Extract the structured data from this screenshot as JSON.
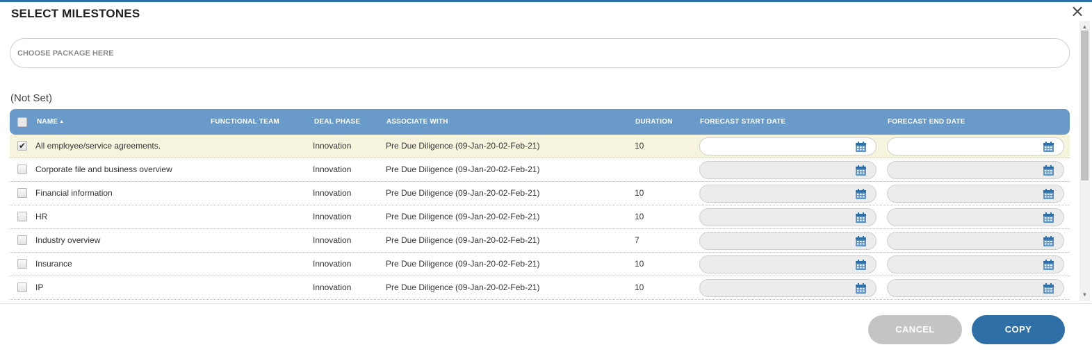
{
  "dialog": {
    "title": "SELECT MILESTONES",
    "close_icon": "×"
  },
  "package": {
    "placeholder": "CHOOSE PACKAGE HERE",
    "value": ""
  },
  "group_label": "(Not Set)",
  "table": {
    "columns": {
      "name": "NAME",
      "functional_team": "FUNCTIONAL TEAM",
      "deal_phase": "DEAL PHASE",
      "associate_with": "ASSOCIATE WITH",
      "duration": "DURATION",
      "forecast_start": "FORECAST START DATE",
      "forecast_end": "FORECAST END DATE"
    },
    "sort": {
      "column": "name",
      "direction": "asc",
      "icon": "▲"
    },
    "rows": [
      {
        "checked": true,
        "check_mark": "✔",
        "name": "All employee/service agreements.",
        "functional_team": "",
        "deal_phase": "Innovation",
        "associate_with": "Pre Due Diligence (09-Jan-20-02-Feb-21)",
        "duration": "10",
        "start": "",
        "end": ""
      },
      {
        "checked": false,
        "check_mark": "",
        "name": "Corporate file and business overview",
        "functional_team": "",
        "deal_phase": "Innovation",
        "associate_with": "Pre Due Diligence (09-Jan-20-02-Feb-21)",
        "duration": "",
        "start": "",
        "end": ""
      },
      {
        "checked": false,
        "check_mark": "",
        "name": "Financial information",
        "functional_team": "",
        "deal_phase": "Innovation",
        "associate_with": "Pre Due Diligence (09-Jan-20-02-Feb-21)",
        "duration": "10",
        "start": "",
        "end": ""
      },
      {
        "checked": false,
        "check_mark": "",
        "name": "HR",
        "functional_team": "",
        "deal_phase": "Innovation",
        "associate_with": "Pre Due Diligence (09-Jan-20-02-Feb-21)",
        "duration": "10",
        "start": "",
        "end": ""
      },
      {
        "checked": false,
        "check_mark": "",
        "name": "Industry overview",
        "functional_team": "",
        "deal_phase": "Innovation",
        "associate_with": "Pre Due Diligence (09-Jan-20-02-Feb-21)",
        "duration": "7",
        "start": "",
        "end": ""
      },
      {
        "checked": false,
        "check_mark": "",
        "name": "Insurance",
        "functional_team": "",
        "deal_phase": "Innovation",
        "associate_with": "Pre Due Diligence (09-Jan-20-02-Feb-21)",
        "duration": "10",
        "start": "",
        "end": ""
      },
      {
        "checked": false,
        "check_mark": "",
        "name": "IP",
        "functional_team": "",
        "deal_phase": "Innovation",
        "associate_with": "Pre Due Diligence (09-Jan-20-02-Feb-21)",
        "duration": "10",
        "start": "",
        "end": ""
      }
    ]
  },
  "buttons": {
    "cancel": "CANCEL",
    "copy": "COPY"
  },
  "colors": {
    "header_bg": "#6a9ac9",
    "primary": "#2e6fa7",
    "selected_row_bg": "#f7f4dd",
    "disabled_button": "#c4c4c4"
  },
  "icons": {
    "calendar": "calendar-icon",
    "close": "close-icon",
    "sort": "sort-asc-icon"
  }
}
